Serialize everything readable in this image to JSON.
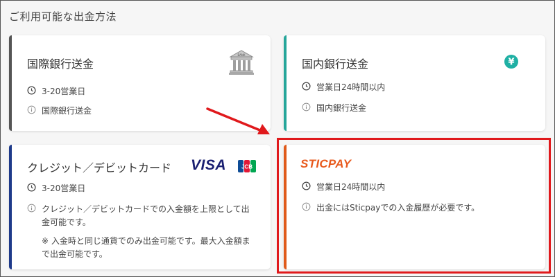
{
  "section_title": "ご利用可能な出金方法",
  "colors": {
    "intl_accent": "#555555",
    "domestic_accent": "#26a69a",
    "card_accent": "#1e3a8a",
    "sticpay_accent": "#e05a1a",
    "highlight": "#e0191c",
    "visa": "#1a1f71",
    "sticpay_logo": "#e8591c"
  },
  "cards": {
    "international": {
      "title": "国際銀行送金",
      "icon": "bank-icon",
      "bank_sign": "BANK",
      "time": "3-20営業日",
      "info": "国際銀行送金"
    },
    "domestic": {
      "title": "国内銀行送金",
      "icon": "yen-icon",
      "yen_symbol": "¥",
      "time": "営業日24時間以内",
      "info": "国内銀行送金"
    },
    "credit": {
      "title": "クレジット／デビットカード",
      "visa_logo": "VISA",
      "jcb_logo": "JCB",
      "time": "3-20営業日",
      "info_line1": "クレジット／デビットカードでの入金額を上限として出",
      "info_line2": "金可能です。",
      "note_line1": "※ 入金時と同じ通貨でのみ出金可能です。最大入金額ま",
      "note_line2": "で出金可能です。"
    },
    "sticpay": {
      "logo": "STICPAY",
      "time": "営業日24時間以内",
      "info": "出金にはSticpayでの入金履歴が必要です。"
    }
  }
}
